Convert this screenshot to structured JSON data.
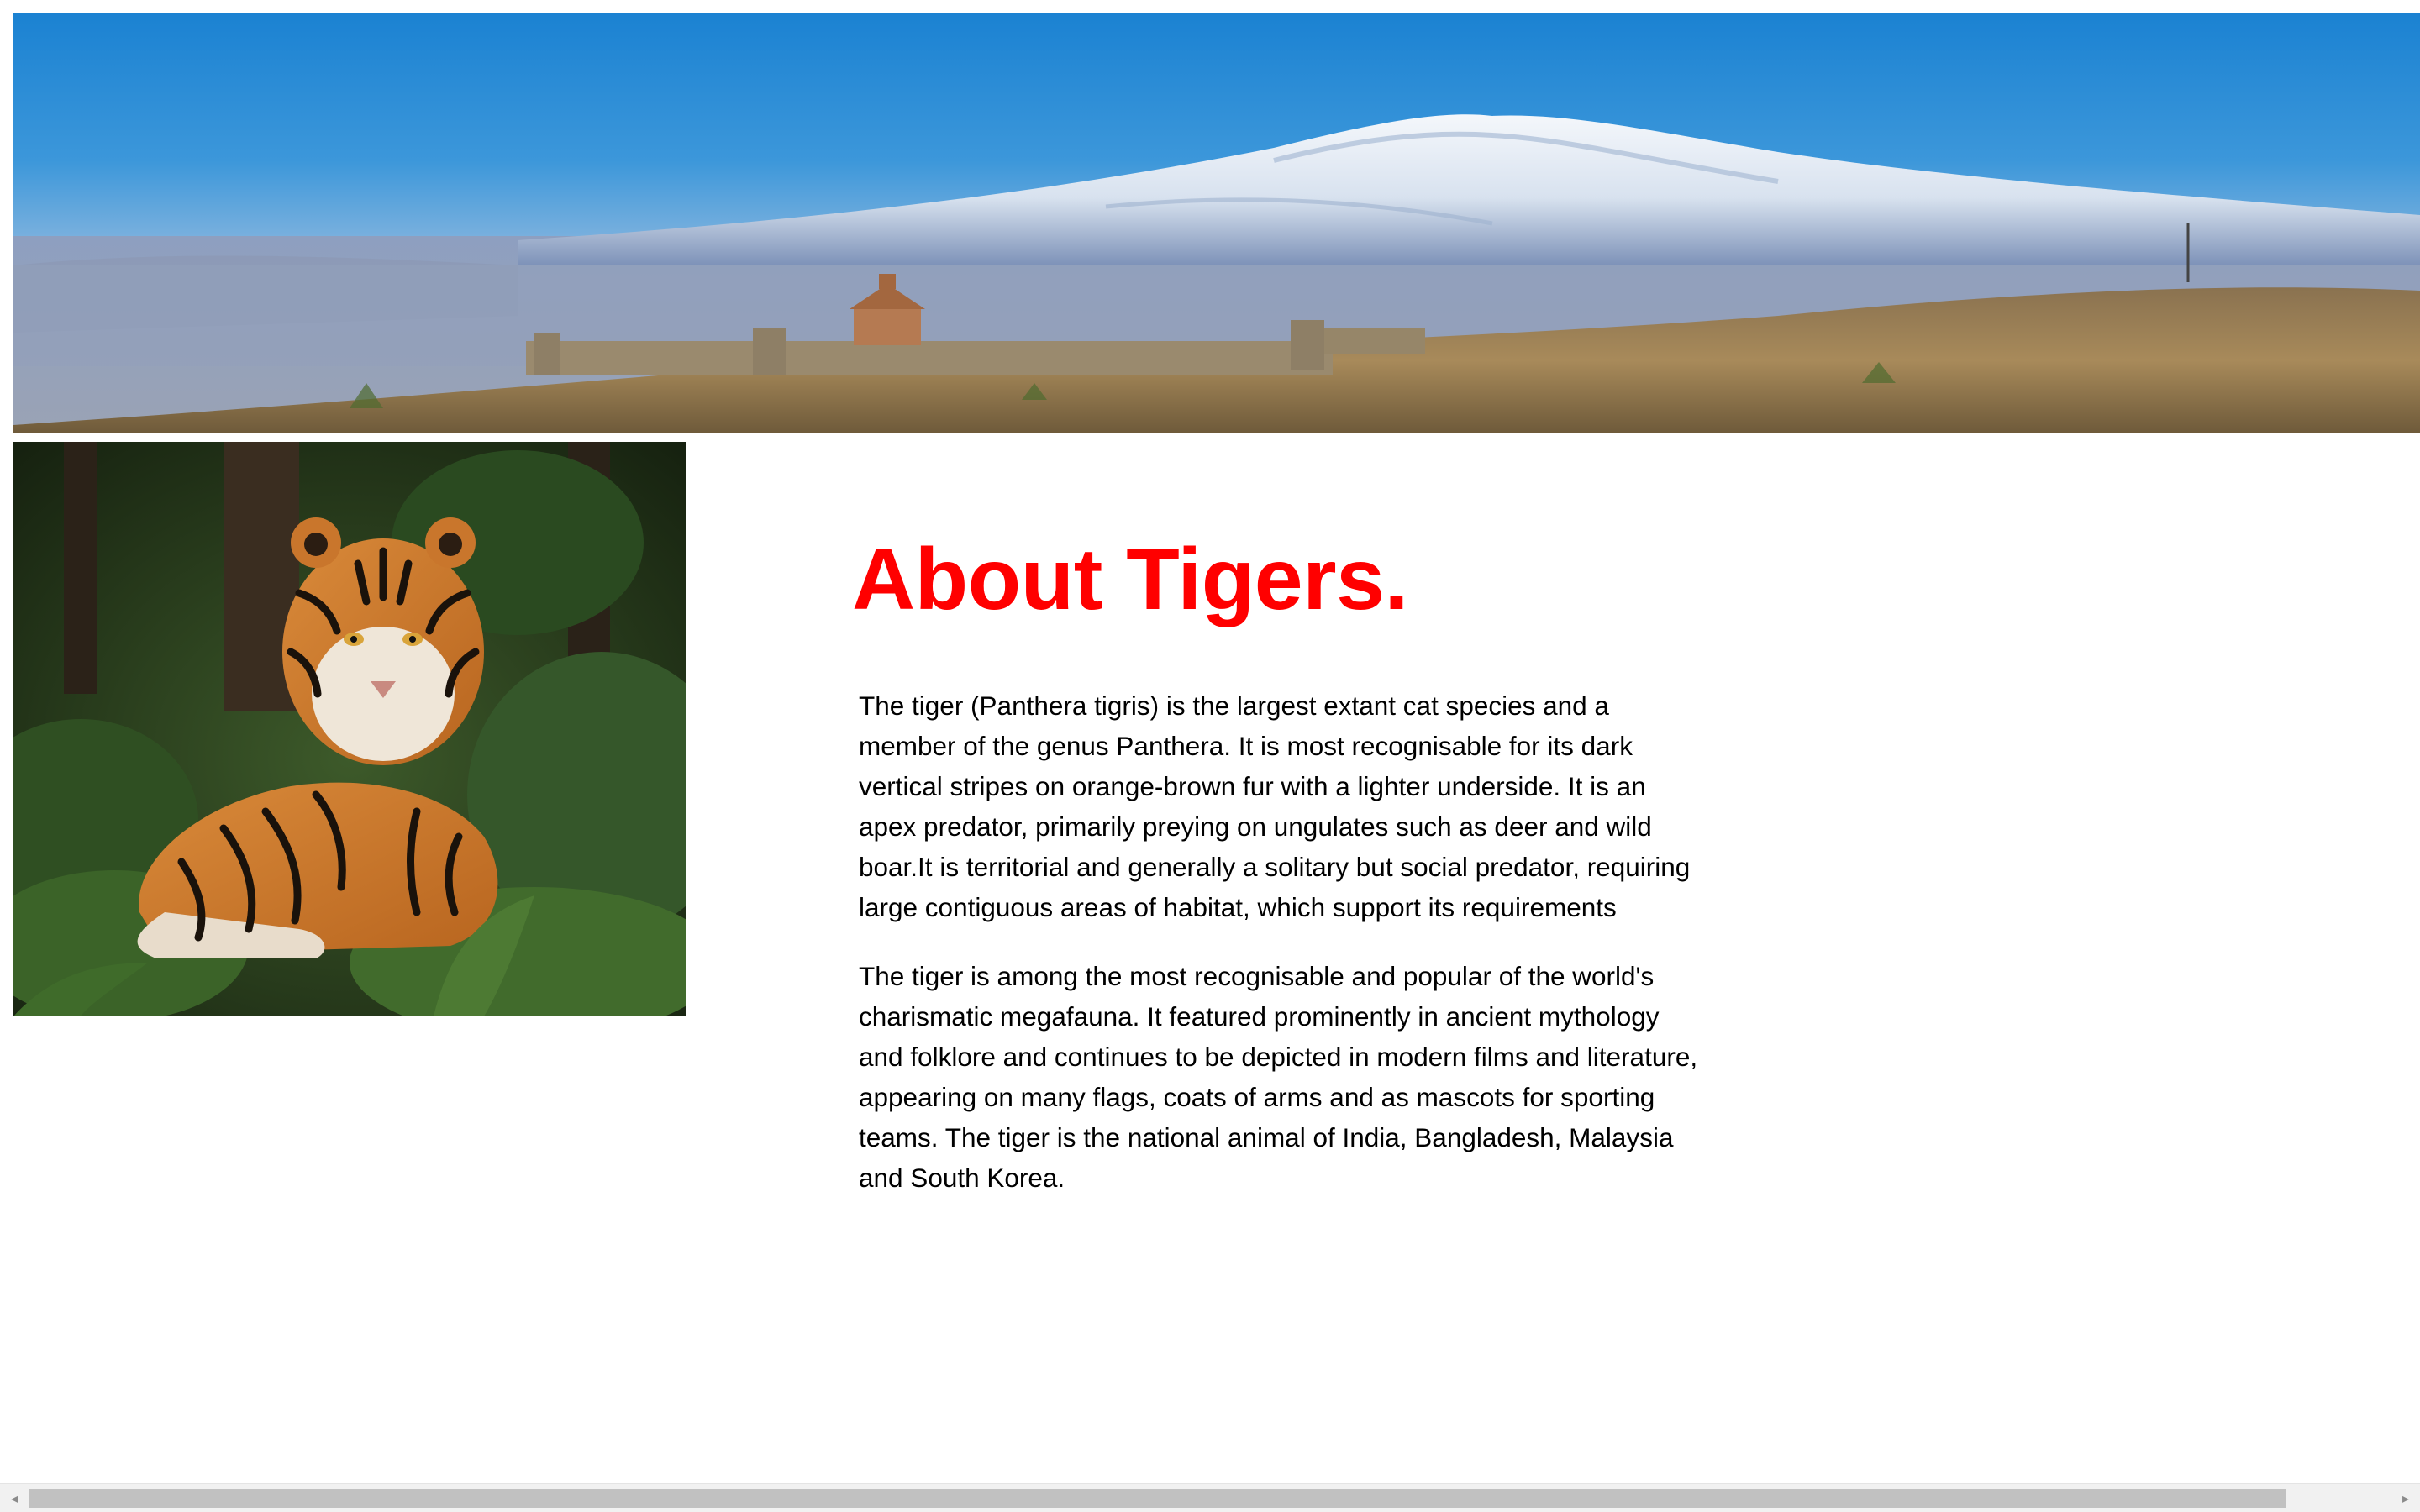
{
  "banner": {
    "icon": "landscape-banner-image",
    "description": "mountain panorama"
  },
  "tiger_image": {
    "icon": "tiger-photo",
    "colors": {
      "fur": "#c9762c",
      "foliage": "#3f6b2a"
    }
  },
  "article": {
    "title": "About Tigers.",
    "paragraph_1": "The tiger (Panthera tigris) is the largest extant cat species and a member of the genus Panthera. It is most recognisable for its dark vertical stripes on orange-brown fur with a lighter underside. It is an apex predator, primarily preying on ungulates such as deer and wild boar.It is territorial and generally a solitary but social predator, requiring large contiguous areas of habitat, which support its requirements",
    "paragraph_2": "The tiger is among the most recognisable and popular of the world's charismatic megafauna. It featured prominently in ancient mythology and folklore and continues to be depicted in modern films and literature, appearing on many flags, coats of arms and as mascots for sporting teams. The tiger is the national animal of India, Bangladesh, Malaysia and South Korea."
  },
  "colors": {
    "title": "#ff0000",
    "text": "#000000",
    "background": "#ffffff",
    "scrollbar_track": "#f1f1f1",
    "scrollbar_thumb": "#c1c1c1"
  },
  "scrollbar": {
    "left_arrow_icon": "◂",
    "right_arrow_icon": "▸"
  }
}
